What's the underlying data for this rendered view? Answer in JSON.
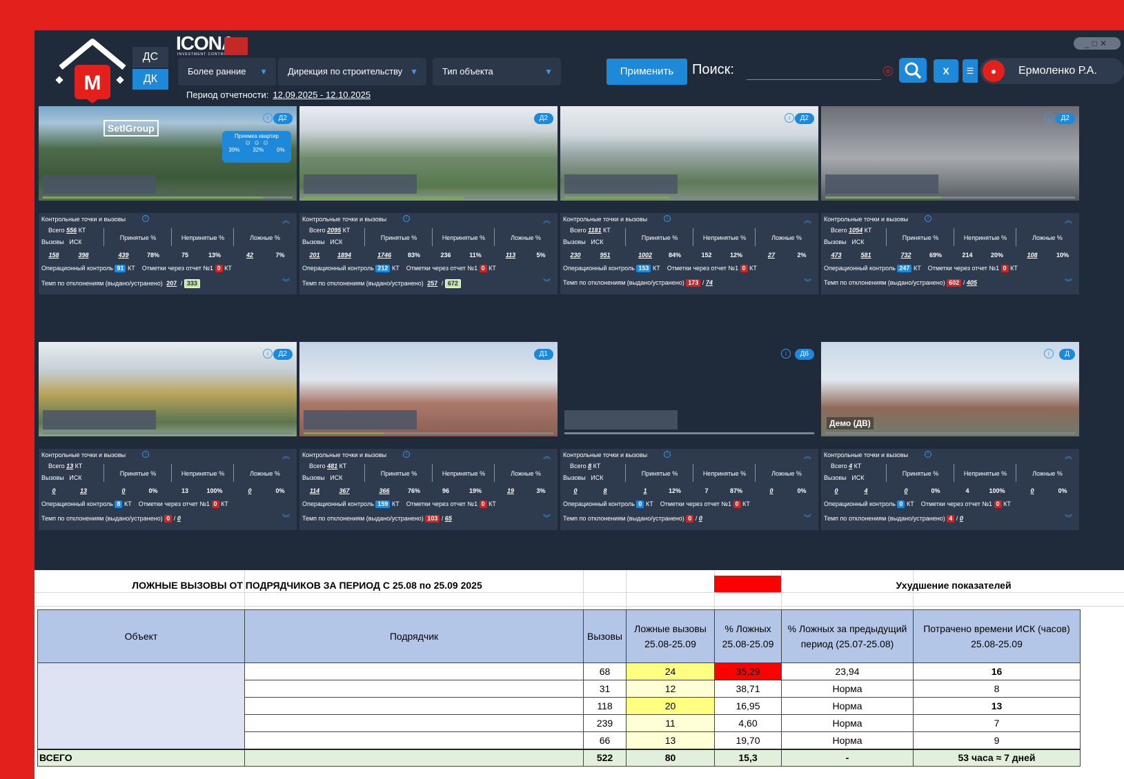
{
  "header": {
    "logo_letter": "M",
    "ds_label": "ДС",
    "dk_label": "ДК",
    "brand": "ICONA",
    "brand_sub": "INVESTMENT CONTROL",
    "filter_period": "Более ранние",
    "filter_direction": "Дирекция по строительству",
    "filter_type": "Тип объекта",
    "period_label": "Период отчетности:",
    "period_value": "12.09.2025 - 12.10.2025",
    "apply_label": "Применить",
    "search_label": "Поиск:",
    "search_value": "",
    "excel_label": "X",
    "user_name": "Ермоленко Р.А."
  },
  "panel_labels": {
    "title": "Контрольные точки и вызовы",
    "total": "Всего",
    "kt": "КТ",
    "calls": "Вызовы",
    "isk": "ИСК",
    "accepted": "Принятые %",
    "rejected": "Непринятые %",
    "false": "Ложные %",
    "opctrl": "Операционный контроль",
    "report": "Отметки через отчет №1",
    "tempo": "Темп по отклонениям (выдано/устранено)"
  },
  "cards": [
    {
      "badge": "Д2",
      "overlay_name": "",
      "brand_overlay": "SetlGroup",
      "priemka_title": "Приемка квартир",
      "priemka_values": [
        "39%",
        "32%",
        "0%"
      ],
      "total": "556",
      "calls": "158",
      "isk": "398",
      "acc": "439",
      "acc_pct": "78%",
      "rej": "75",
      "rej_pct": "13%",
      "fal": "42",
      "fal_pct": "7%",
      "opctrl": "91",
      "report": "0",
      "issued": "207",
      "fixed": "333",
      "issued_red": false,
      "progress": 0.88
    },
    {
      "badge": "Д2",
      "overlay_name": "",
      "total": "2095",
      "calls": "201",
      "isk": "1894",
      "acc": "1746",
      "acc_pct": "83%",
      "rej": "236",
      "rej_pct": "11%",
      "fal": "113",
      "fal_pct": "5%",
      "opctrl": "212",
      "report": "0",
      "issued": "257",
      "fixed": "672",
      "issued_red": false,
      "progress": 0.64
    },
    {
      "badge": "Д2",
      "overlay_name": "",
      "total": "1181",
      "calls": "230",
      "isk": "951",
      "acc": "1002",
      "acc_pct": "84%",
      "rej": "152",
      "rej_pct": "12%",
      "fal": "27",
      "fal_pct": "2%",
      "opctrl": "153",
      "report": "0",
      "issued": "173",
      "fixed": "74",
      "issued_red": true,
      "progress": 0.42
    },
    {
      "badge": "Д2",
      "overlay_name": "",
      "total": "1054",
      "calls": "473",
      "isk": "581",
      "acc": "732",
      "acc_pct": "69%",
      "rej": "214",
      "rej_pct": "20%",
      "fal": "108",
      "fal_pct": "10%",
      "opctrl": "247",
      "report": "0",
      "issued": "602",
      "fixed": "405",
      "issued_red": true,
      "progress": 0.46
    },
    {
      "badge": "Д2",
      "overlay_name": "",
      "total": "13",
      "calls": "0",
      "isk": "13",
      "acc": "0",
      "acc_pct": "0%",
      "rej": "13",
      "rej_pct": "100%",
      "fal": "0",
      "fal_pct": "0%",
      "opctrl": "8",
      "report": "0",
      "issued": "0",
      "fixed": "0",
      "issued_red": true,
      "progress": 0.0
    },
    {
      "badge": "Д1",
      "overlay_name": "",
      "total": "481",
      "calls": "114",
      "isk": "367",
      "acc": "366",
      "acc_pct": "76%",
      "rej": "96",
      "rej_pct": "19%",
      "fal": "19",
      "fal_pct": "3%",
      "opctrl": "159",
      "report": "0",
      "issued": "103",
      "fixed": "65",
      "issued_red": true,
      "progress": 0.32
    },
    {
      "badge": "Д6",
      "overlay_name": "",
      "total": "8",
      "calls": "0",
      "isk": "8",
      "acc": "1",
      "acc_pct": "12%",
      "rej": "7",
      "rej_pct": "87%",
      "fal": "0",
      "fal_pct": "0%",
      "opctrl": "0",
      "report": "0",
      "issued": "0",
      "fixed": "0",
      "issued_red": true,
      "progress": 0.0
    },
    {
      "badge": "Д",
      "overlay_name": "Демо (ДВ)",
      "total": "4",
      "calls": "0",
      "isk": "4",
      "acc": "0",
      "acc_pct": "0%",
      "rej": "4",
      "rej_pct": "100%",
      "fal": "0",
      "fal_pct": "0%",
      "opctrl": "0",
      "report": "0",
      "issued": "4",
      "fixed": "0",
      "issued_red": true,
      "progress": 0.0
    }
  ],
  "sheet": {
    "title": "ЛОЖНЫЕ ВЫЗОВЫ ОТ ПОДРЯДЧИКОВ ЗА ПЕРИОД С 25.08 по 25.09 2025",
    "legend": "Ухудшение показателей",
    "legend_color": "#ff0000",
    "headers": [
      "Объект",
      "Подрядчик",
      "Вызовы",
      "Ложные вызовы 25.08-25.09",
      "% Ложных 25.08-25.09",
      "% Ложных за предыдущий период (25.07-25.08)",
      "Потрачено времени ИСК (часов) 25.08-25.09"
    ],
    "rows": [
      {
        "calls": "68",
        "false": "24",
        "pct": "35,29",
        "prev": "23,94",
        "hours": "16"
      },
      {
        "calls": "31",
        "false": "12",
        "pct": "38,71",
        "prev": "Норма",
        "hours": "8"
      },
      {
        "calls": "118",
        "false": "20",
        "pct": "16,95",
        "prev": "Норма",
        "hours": "13"
      },
      {
        "calls": "239",
        "false": "11",
        "pct": "4,60",
        "prev": "Норма",
        "hours": "7"
      },
      {
        "calls": "66",
        "false": "13",
        "pct": "19,70",
        "prev": "Норма",
        "hours": "9"
      }
    ],
    "total": {
      "label": "ВСЕГО",
      "calls": "522",
      "false": "80",
      "pct": "15,3",
      "prev": "-",
      "hours": "53 часа ≈ 7 дней"
    }
  }
}
